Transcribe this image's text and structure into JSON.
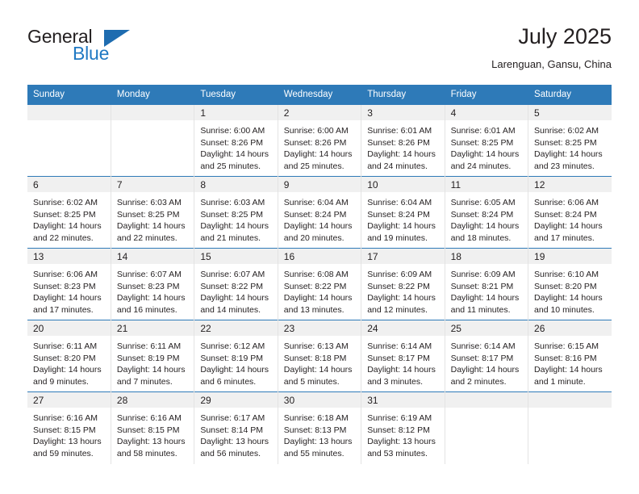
{
  "brand": {
    "name_top": "General",
    "name_bottom": "Blue",
    "triangle_color": "#1e6cb0",
    "blue_color": "#2079c3"
  },
  "header": {
    "title": "July 2025",
    "location": "Larenguan, Gansu, China"
  },
  "theme": {
    "header_blue": "#2e7ab8",
    "daynum_band": "#f0f0f0",
    "text": "#231f20"
  },
  "weekday_headers": [
    "Sunday",
    "Monday",
    "Tuesday",
    "Wednesday",
    "Thursday",
    "Friday",
    "Saturday"
  ],
  "labels": {
    "sunrise_prefix": "Sunrise:",
    "sunset_prefix": "Sunset:",
    "daylight_prefix": "Daylight:"
  },
  "weeks": [
    [
      {
        "day": "",
        "blank": true,
        "sunrise": "",
        "sunset": "",
        "daylight_line1": "",
        "daylight_line2": ""
      },
      {
        "day": "",
        "blank": true,
        "sunrise": "",
        "sunset": "",
        "daylight_line1": "",
        "daylight_line2": ""
      },
      {
        "day": "1",
        "blank": false,
        "sunrise": "Sunrise: 6:00 AM",
        "sunset": "Sunset: 8:26 PM",
        "daylight_line1": "Daylight: 14 hours",
        "daylight_line2": "and 25 minutes."
      },
      {
        "day": "2",
        "blank": false,
        "sunrise": "Sunrise: 6:00 AM",
        "sunset": "Sunset: 8:26 PM",
        "daylight_line1": "Daylight: 14 hours",
        "daylight_line2": "and 25 minutes."
      },
      {
        "day": "3",
        "blank": false,
        "sunrise": "Sunrise: 6:01 AM",
        "sunset": "Sunset: 8:26 PM",
        "daylight_line1": "Daylight: 14 hours",
        "daylight_line2": "and 24 minutes."
      },
      {
        "day": "4",
        "blank": false,
        "sunrise": "Sunrise: 6:01 AM",
        "sunset": "Sunset: 8:25 PM",
        "daylight_line1": "Daylight: 14 hours",
        "daylight_line2": "and 24 minutes."
      },
      {
        "day": "5",
        "blank": false,
        "sunrise": "Sunrise: 6:02 AM",
        "sunset": "Sunset: 8:25 PM",
        "daylight_line1": "Daylight: 14 hours",
        "daylight_line2": "and 23 minutes."
      }
    ],
    [
      {
        "day": "6",
        "blank": false,
        "sunrise": "Sunrise: 6:02 AM",
        "sunset": "Sunset: 8:25 PM",
        "daylight_line1": "Daylight: 14 hours",
        "daylight_line2": "and 22 minutes."
      },
      {
        "day": "7",
        "blank": false,
        "sunrise": "Sunrise: 6:03 AM",
        "sunset": "Sunset: 8:25 PM",
        "daylight_line1": "Daylight: 14 hours",
        "daylight_line2": "and 22 minutes."
      },
      {
        "day": "8",
        "blank": false,
        "sunrise": "Sunrise: 6:03 AM",
        "sunset": "Sunset: 8:25 PM",
        "daylight_line1": "Daylight: 14 hours",
        "daylight_line2": "and 21 minutes."
      },
      {
        "day": "9",
        "blank": false,
        "sunrise": "Sunrise: 6:04 AM",
        "sunset": "Sunset: 8:24 PM",
        "daylight_line1": "Daylight: 14 hours",
        "daylight_line2": "and 20 minutes."
      },
      {
        "day": "10",
        "blank": false,
        "sunrise": "Sunrise: 6:04 AM",
        "sunset": "Sunset: 8:24 PM",
        "daylight_line1": "Daylight: 14 hours",
        "daylight_line2": "and 19 minutes."
      },
      {
        "day": "11",
        "blank": false,
        "sunrise": "Sunrise: 6:05 AM",
        "sunset": "Sunset: 8:24 PM",
        "daylight_line1": "Daylight: 14 hours",
        "daylight_line2": "and 18 minutes."
      },
      {
        "day": "12",
        "blank": false,
        "sunrise": "Sunrise: 6:06 AM",
        "sunset": "Sunset: 8:24 PM",
        "daylight_line1": "Daylight: 14 hours",
        "daylight_line2": "and 17 minutes."
      }
    ],
    [
      {
        "day": "13",
        "blank": false,
        "sunrise": "Sunrise: 6:06 AM",
        "sunset": "Sunset: 8:23 PM",
        "daylight_line1": "Daylight: 14 hours",
        "daylight_line2": "and 17 minutes."
      },
      {
        "day": "14",
        "blank": false,
        "sunrise": "Sunrise: 6:07 AM",
        "sunset": "Sunset: 8:23 PM",
        "daylight_line1": "Daylight: 14 hours",
        "daylight_line2": "and 16 minutes."
      },
      {
        "day": "15",
        "blank": false,
        "sunrise": "Sunrise: 6:07 AM",
        "sunset": "Sunset: 8:22 PM",
        "daylight_line1": "Daylight: 14 hours",
        "daylight_line2": "and 14 minutes."
      },
      {
        "day": "16",
        "blank": false,
        "sunrise": "Sunrise: 6:08 AM",
        "sunset": "Sunset: 8:22 PM",
        "daylight_line1": "Daylight: 14 hours",
        "daylight_line2": "and 13 minutes."
      },
      {
        "day": "17",
        "blank": false,
        "sunrise": "Sunrise: 6:09 AM",
        "sunset": "Sunset: 8:22 PM",
        "daylight_line1": "Daylight: 14 hours",
        "daylight_line2": "and 12 minutes."
      },
      {
        "day": "18",
        "blank": false,
        "sunrise": "Sunrise: 6:09 AM",
        "sunset": "Sunset: 8:21 PM",
        "daylight_line1": "Daylight: 14 hours",
        "daylight_line2": "and 11 minutes."
      },
      {
        "day": "19",
        "blank": false,
        "sunrise": "Sunrise: 6:10 AM",
        "sunset": "Sunset: 8:20 PM",
        "daylight_line1": "Daylight: 14 hours",
        "daylight_line2": "and 10 minutes."
      }
    ],
    [
      {
        "day": "20",
        "blank": false,
        "sunrise": "Sunrise: 6:11 AM",
        "sunset": "Sunset: 8:20 PM",
        "daylight_line1": "Daylight: 14 hours",
        "daylight_line2": "and 9 minutes."
      },
      {
        "day": "21",
        "blank": false,
        "sunrise": "Sunrise: 6:11 AM",
        "sunset": "Sunset: 8:19 PM",
        "daylight_line1": "Daylight: 14 hours",
        "daylight_line2": "and 7 minutes."
      },
      {
        "day": "22",
        "blank": false,
        "sunrise": "Sunrise: 6:12 AM",
        "sunset": "Sunset: 8:19 PM",
        "daylight_line1": "Daylight: 14 hours",
        "daylight_line2": "and 6 minutes."
      },
      {
        "day": "23",
        "blank": false,
        "sunrise": "Sunrise: 6:13 AM",
        "sunset": "Sunset: 8:18 PM",
        "daylight_line1": "Daylight: 14 hours",
        "daylight_line2": "and 5 minutes."
      },
      {
        "day": "24",
        "blank": false,
        "sunrise": "Sunrise: 6:14 AM",
        "sunset": "Sunset: 8:17 PM",
        "daylight_line1": "Daylight: 14 hours",
        "daylight_line2": "and 3 minutes."
      },
      {
        "day": "25",
        "blank": false,
        "sunrise": "Sunrise: 6:14 AM",
        "sunset": "Sunset: 8:17 PM",
        "daylight_line1": "Daylight: 14 hours",
        "daylight_line2": "and 2 minutes."
      },
      {
        "day": "26",
        "blank": false,
        "sunrise": "Sunrise: 6:15 AM",
        "sunset": "Sunset: 8:16 PM",
        "daylight_line1": "Daylight: 14 hours",
        "daylight_line2": "and 1 minute."
      }
    ],
    [
      {
        "day": "27",
        "blank": false,
        "sunrise": "Sunrise: 6:16 AM",
        "sunset": "Sunset: 8:15 PM",
        "daylight_line1": "Daylight: 13 hours",
        "daylight_line2": "and 59 minutes."
      },
      {
        "day": "28",
        "blank": false,
        "sunrise": "Sunrise: 6:16 AM",
        "sunset": "Sunset: 8:15 PM",
        "daylight_line1": "Daylight: 13 hours",
        "daylight_line2": "and 58 minutes."
      },
      {
        "day": "29",
        "blank": false,
        "sunrise": "Sunrise: 6:17 AM",
        "sunset": "Sunset: 8:14 PM",
        "daylight_line1": "Daylight: 13 hours",
        "daylight_line2": "and 56 minutes."
      },
      {
        "day": "30",
        "blank": false,
        "sunrise": "Sunrise: 6:18 AM",
        "sunset": "Sunset: 8:13 PM",
        "daylight_line1": "Daylight: 13 hours",
        "daylight_line2": "and 55 minutes."
      },
      {
        "day": "31",
        "blank": false,
        "sunrise": "Sunrise: 6:19 AM",
        "sunset": "Sunset: 8:12 PM",
        "daylight_line1": "Daylight: 13 hours",
        "daylight_line2": "and 53 minutes."
      },
      {
        "day": "",
        "blank": true,
        "sunrise": "",
        "sunset": "",
        "daylight_line1": "",
        "daylight_line2": ""
      },
      {
        "day": "",
        "blank": true,
        "sunrise": "",
        "sunset": "",
        "daylight_line1": "",
        "daylight_line2": ""
      }
    ]
  ]
}
